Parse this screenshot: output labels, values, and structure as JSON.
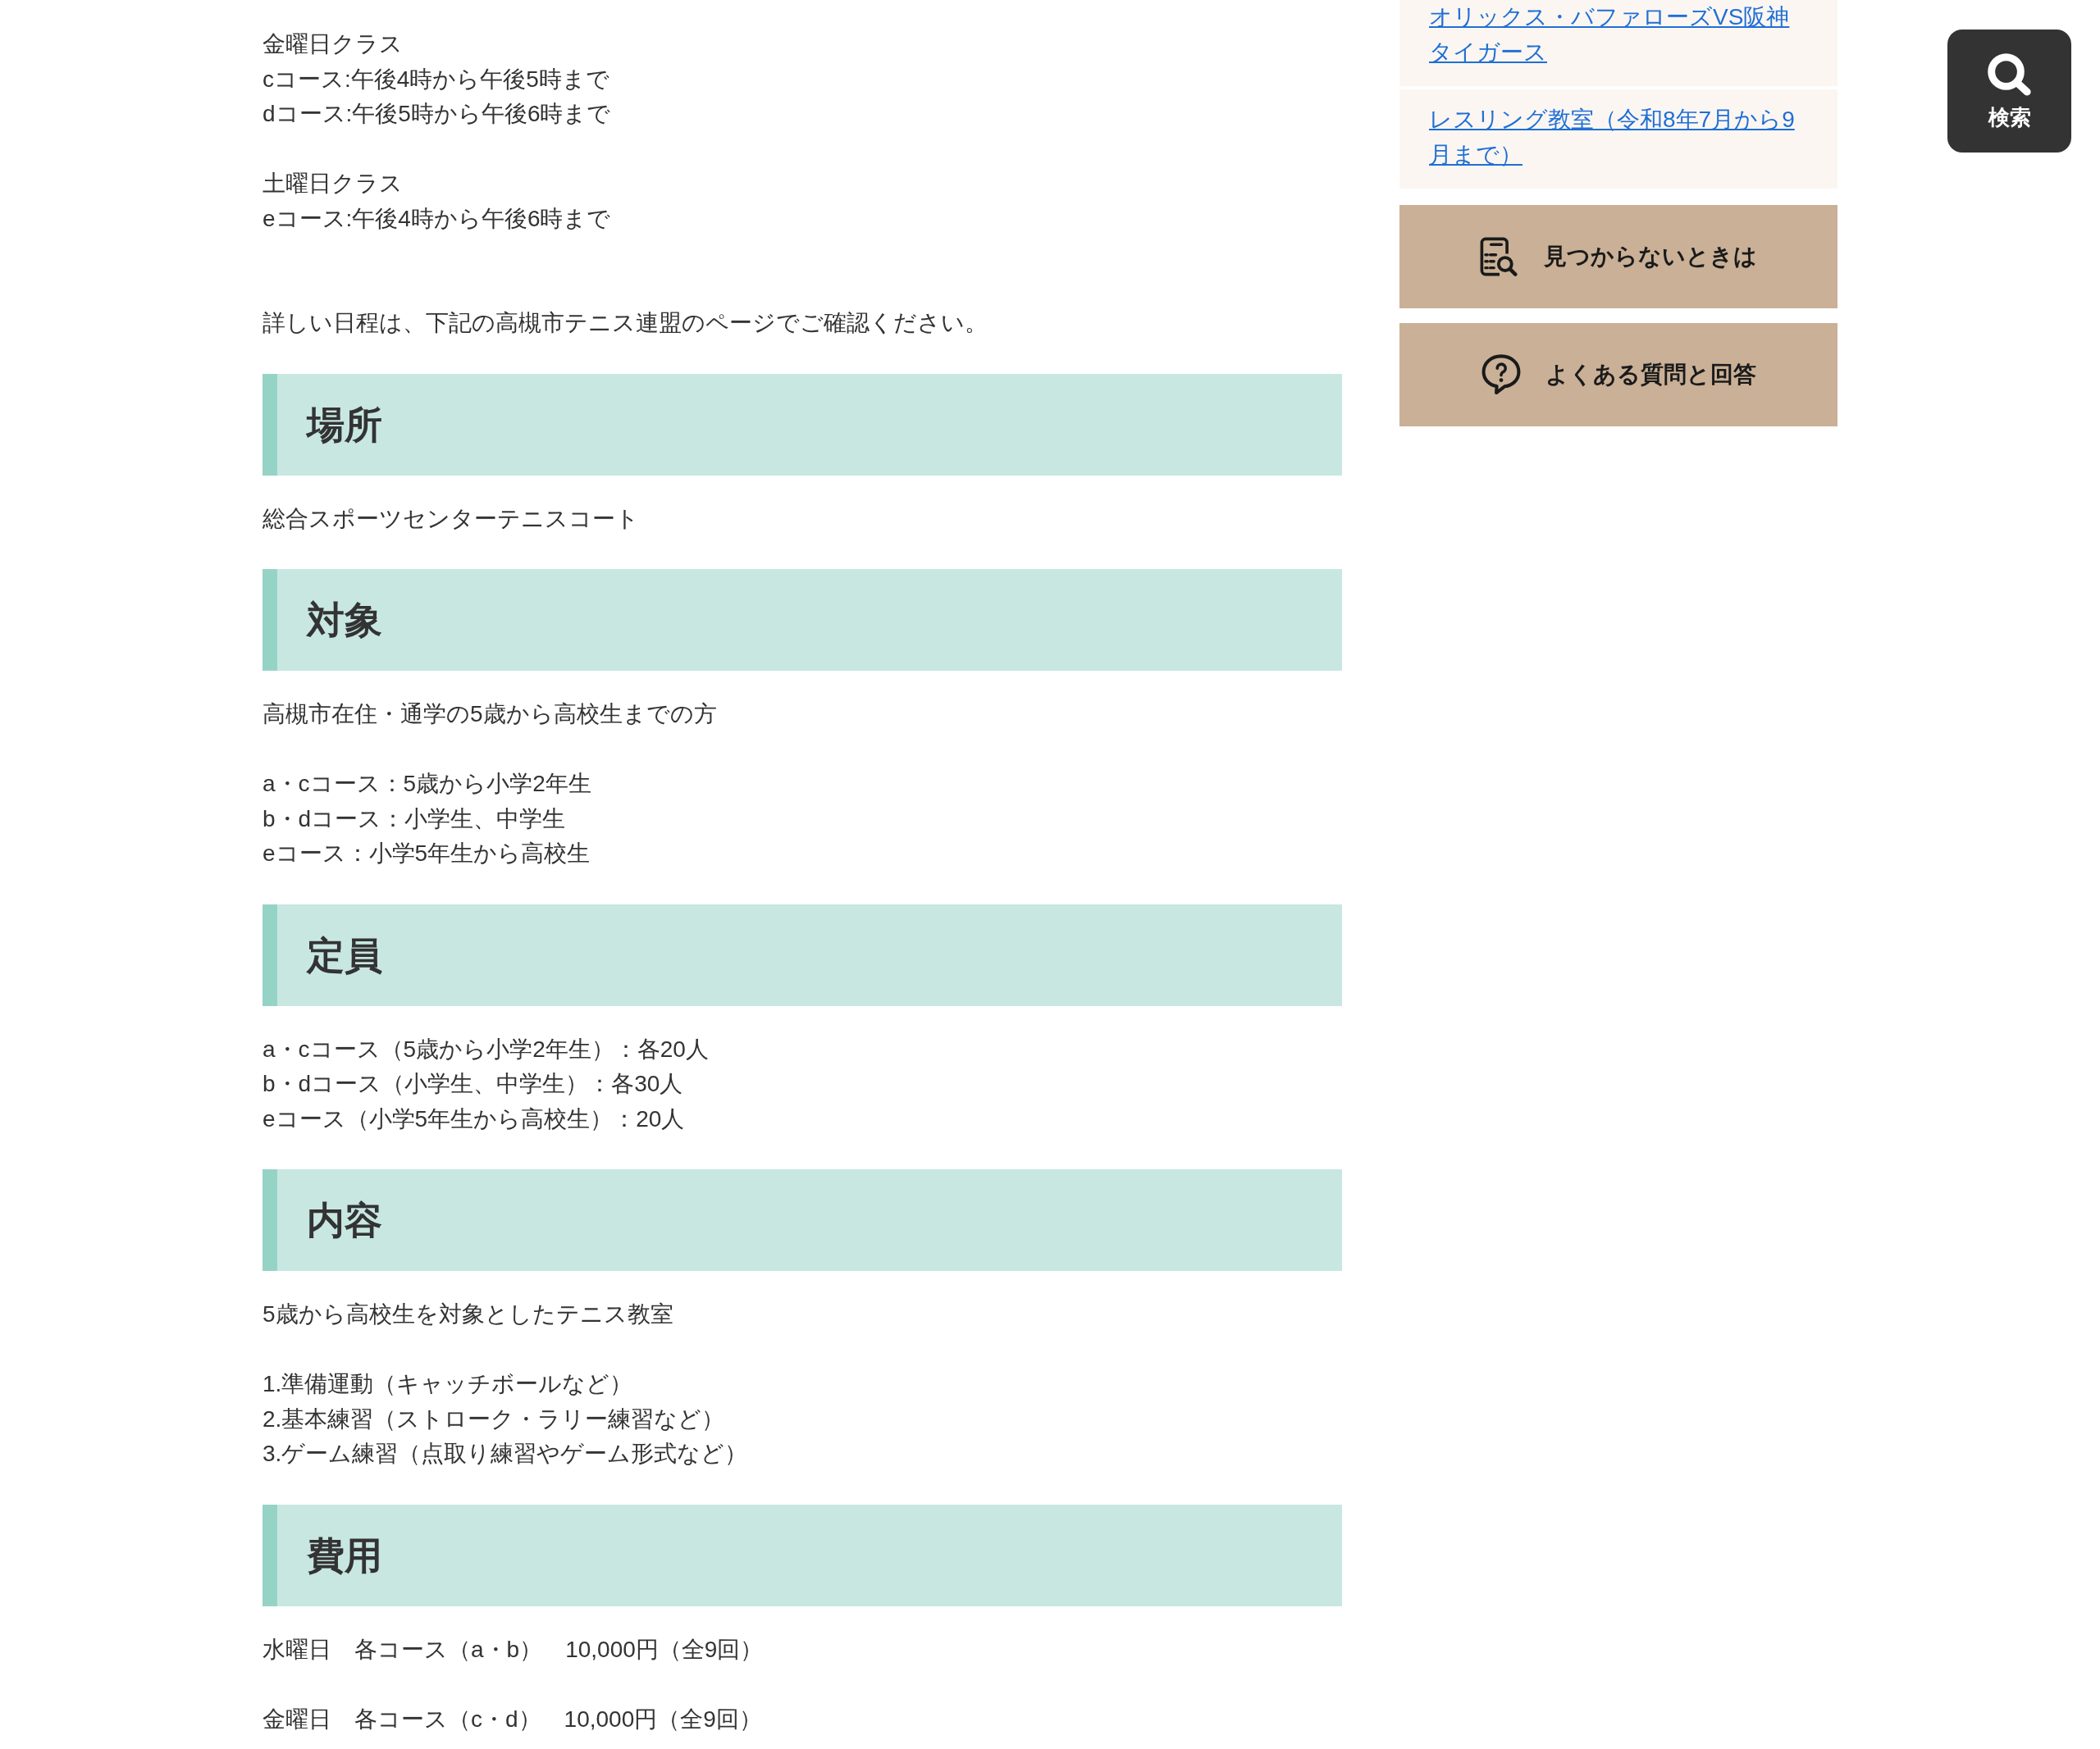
{
  "schedule": {
    "paragraphs": [
      [
        "金曜日クラス",
        "cコース:午後4時から午後5時まで",
        "dコース:午後5時から午後6時まで"
      ],
      [
        "土曜日クラス",
        "eコース:午後4時から午後6時まで"
      ]
    ],
    "note": "詳しい日程は、下記の高槻市テニス連盟のページでご確認ください。"
  },
  "sections": [
    {
      "heading": "場所",
      "paragraphs": [
        [
          "総合スポーツセンターテニスコート"
        ]
      ]
    },
    {
      "heading": "対象",
      "paragraphs": [
        [
          "高槻市在住・通学の5歳から高校生までの方"
        ],
        [
          "a・cコース：5歳から小学2年生",
          "b・dコース：小学生、中学生",
          "eコース：小学5年生から高校生"
        ]
      ]
    },
    {
      "heading": "定員",
      "paragraphs": [
        [
          "a・cコース（5歳から小学2年生）：各20人",
          "b・dコース（小学生、中学生）：各30人",
          "eコース（小学5年生から高校生）：20人"
        ]
      ]
    },
    {
      "heading": "内容",
      "paragraphs": [
        [
          "5歳から高校生を対象としたテニス教室"
        ],
        [
          "1.準備運動（キャッチボールなど）",
          "2.基本練習（ストローク・ラリー練習など）",
          "3.ゲーム練習（点取り練習やゲーム形式など）"
        ]
      ]
    },
    {
      "heading": "費用",
      "paragraphs": [
        [
          "水曜日　各コース（a・b）　10,000円（全9回）"
        ],
        [
          "金曜日　各コース（c・d）　10,000円（全9回）"
        ]
      ]
    }
  ],
  "sidebar": {
    "links": [
      {
        "text": "オリックス・バファローズVS阪神タイガース"
      },
      {
        "text": "レスリング教室（令和8年7月から9月まで）"
      }
    ],
    "buttons": [
      {
        "kind": "not-found",
        "label": "見つからないときは"
      },
      {
        "kind": "faq",
        "label": "よくある質問と回答"
      }
    ]
  },
  "search_button": {
    "label": "検索"
  }
}
